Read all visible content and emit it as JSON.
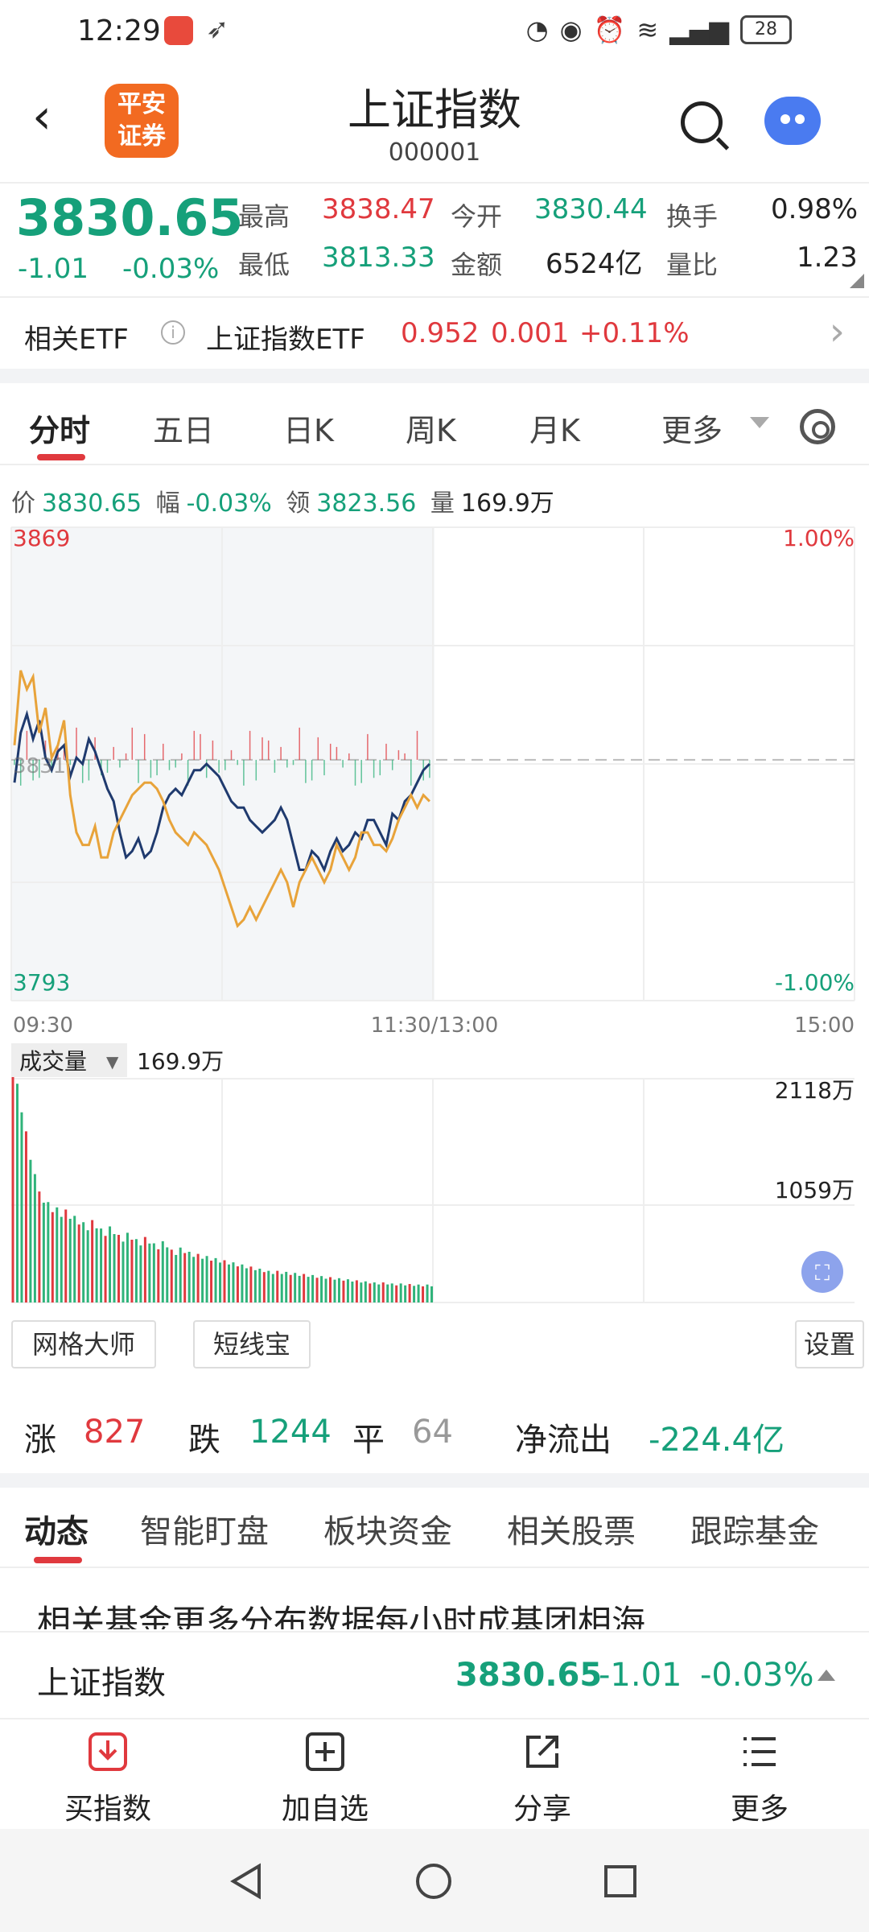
{
  "status_bar": {
    "time": "12:29",
    "battery": "28"
  },
  "header": {
    "title": "上证指数",
    "code": "000001",
    "logo_text": [
      "平安",
      "证券"
    ]
  },
  "quote": {
    "price": "3830.65",
    "change": "-1.01",
    "change_pct": "-0.03%",
    "high_label": "最高",
    "high": "3838.47",
    "low_label": "最低",
    "low": "3813.33",
    "open_label": "今开",
    "open": "3830.44",
    "amount_label": "金额",
    "amount": "6524亿",
    "turnover_label": "换手",
    "turnover": "0.98%",
    "vol_ratio_label": "量比",
    "vol_ratio": "1.23"
  },
  "etf": {
    "label": "相关ETF",
    "name": "上证指数ETF",
    "price": "0.952",
    "change": "0.001",
    "change_pct": "+0.11%"
  },
  "chart_tabs": [
    "分时",
    "五日",
    "日K",
    "周K",
    "月K",
    "更多"
  ],
  "price_bar": {
    "price_label": "价",
    "price": "3830.65",
    "amp_label": "幅",
    "amp": "-0.03%",
    "lead_label": "领",
    "lead": "3823.56",
    "vol_label": "量",
    "vol": "169.9万"
  },
  "chart_data": {
    "type": "line",
    "y_top_label": "3869",
    "y_bottom_label": "3793",
    "y_mid_label": "3831",
    "pct_top_label": "1.00%",
    "pct_bottom_label": "-1.00%",
    "ylim": [
      3793,
      3869
    ],
    "prev_close": 3831.66,
    "x_ticks": [
      "09:30",
      "11:30/13:00",
      "15:00"
    ],
    "total_minutes": 240,
    "series": [
      {
        "color": "#1f3a6e",
        "values": [
          3828,
          3836,
          3839,
          3835,
          3838,
          3832,
          3830,
          3833,
          3834,
          3829,
          3832,
          3831,
          3835,
          3833,
          3830,
          3827,
          3825,
          3820,
          3816,
          3817,
          3819,
          3816,
          3817,
          3820,
          3824,
          3826,
          3827,
          3826,
          3828,
          3830,
          3830,
          3831,
          3830,
          3829,
          3827,
          3825,
          3824,
          3824,
          3822,
          3821,
          3820,
          3821,
          3822,
          3824,
          3822,
          3818,
          3814,
          3814,
          3817,
          3816,
          3814,
          3817,
          3819,
          3817,
          3818,
          3820,
          3819,
          3822,
          3822,
          3820,
          3818,
          3823,
          3822,
          3825,
          3826,
          3828,
          3830,
          3831
        ]
      },
      {
        "color": "#e8a33a",
        "values": [
          3834,
          3846,
          3843,
          3845,
          3836,
          3840,
          3832,
          3834,
          3838,
          3826,
          3820,
          3818,
          3818,
          3821,
          3816,
          3816,
          3820,
          3822,
          3824,
          3826,
          3827,
          3828,
          3828,
          3827,
          3825,
          3822,
          3820,
          3819,
          3818,
          3820,
          3819,
          3818,
          3816,
          3814,
          3811,
          3808,
          3805,
          3806,
          3808,
          3806,
          3808,
          3810,
          3812,
          3814,
          3812,
          3808,
          3812,
          3814,
          3816,
          3814,
          3812,
          3814,
          3818,
          3816,
          3814,
          3816,
          3820,
          3820,
          3818,
          3818,
          3817,
          3819,
          3822,
          3824,
          3826,
          3824,
          3826,
          3825
        ]
      }
    ],
    "volume": {
      "label": "成交量",
      "current": "169.9万",
      "max_label": "2118万",
      "mid_label": "1059万",
      "ylim": [
        0,
        2118
      ],
      "values": [
        2300,
        1800,
        1350,
        1050,
        950,
        900,
        880,
        820,
        760,
        780,
        700,
        720,
        640,
        660,
        600,
        620,
        560,
        580,
        500,
        520,
        480,
        460,
        440,
        420,
        400,
        380,
        360,
        340,
        320,
        300,
        300,
        290,
        280,
        270,
        260,
        250,
        240,
        230,
        220,
        210,
        200,
        190,
        190,
        180,
        180,
        175,
        170,
        170
      ]
    }
  },
  "tools": [
    "网格大师",
    "短线宝",
    "设置"
  ],
  "breadth": {
    "up_label": "涨",
    "up": "827",
    "down_label": "跌",
    "down": "1244",
    "flat_label": "平",
    "flat": "64",
    "flow_label": "净流出",
    "flow": "-224.4亿"
  },
  "news_tabs": [
    "动态",
    "智能盯盘",
    "板块资金",
    "相关股票",
    "跟踪基金"
  ],
  "article_text": "相关基金更多分布数据每小时成基团相海",
  "ticker": {
    "name": "上证指数",
    "price": "3830.65",
    "change": "-1.01",
    "change_pct": "-0.03%"
  },
  "bottom_nav": [
    {
      "label": "买指数",
      "icon": "download-icon"
    },
    {
      "label": "加自选",
      "icon": "add-icon"
    },
    {
      "label": "分享",
      "icon": "share-icon"
    },
    {
      "label": "更多",
      "icon": "menu-icon"
    }
  ]
}
